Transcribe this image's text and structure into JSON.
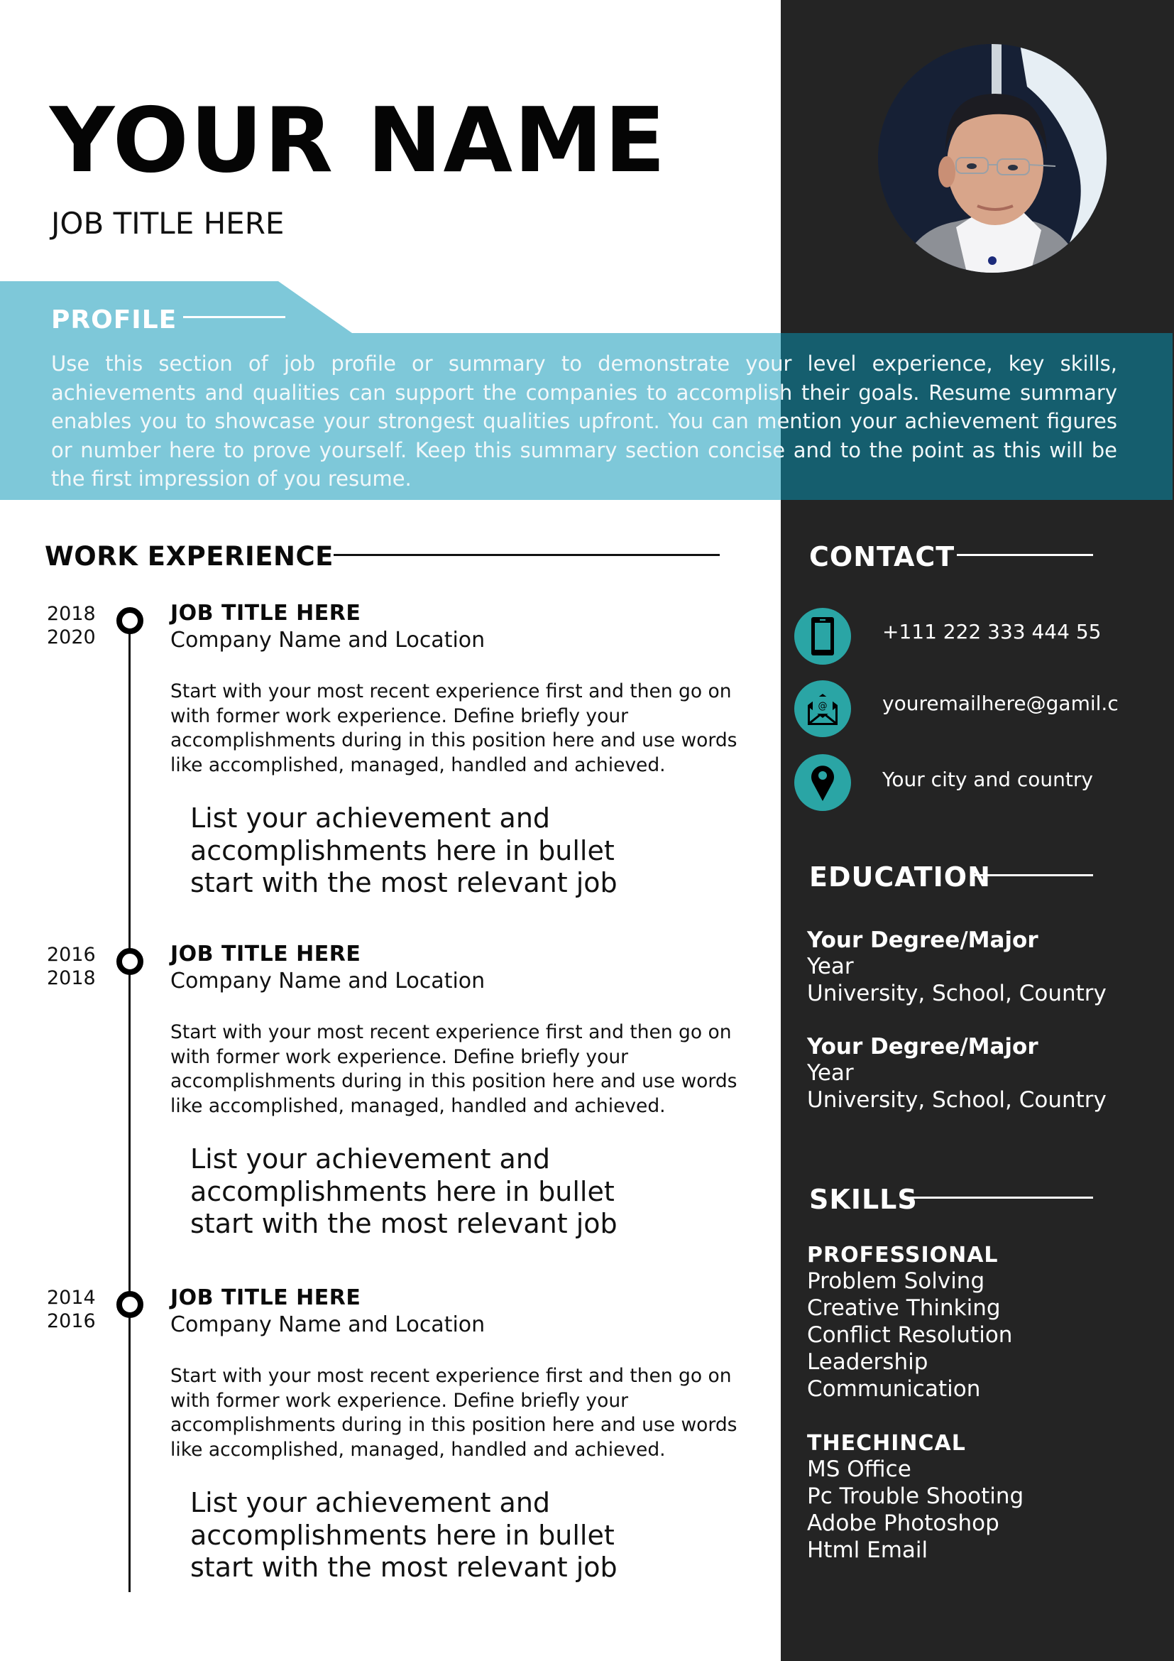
{
  "colors": {
    "sidebar": "#242424",
    "profile_light": "#7ec8d9",
    "profile_dark": "#155e6e",
    "icon_teal": "#2aa5a5",
    "text_dark": "#111111",
    "text_light": "#ffffff"
  },
  "header": {
    "name": "YOUR NAME",
    "job_title": "JOB TITLE HERE",
    "photo_icon": "profile-photo"
  },
  "profile": {
    "title": "PROFILE",
    "text": "Use this section of job profile or summary to demonstrate your level experience, key skills, achievements and qualities can support the companies to accomplish their goals. Resume summary enables you to showcase your strongest qualities upfront. You can mention your achievement figures or number here to prove yourself. Keep this summary section concise and to the point as this will be the first impression of you resume."
  },
  "work_experience": {
    "title": "WORK EXPERIENCE",
    "jobs": [
      {
        "year_start": "2018",
        "year_end": "2020",
        "title": "JOB TITLE HERE",
        "company": "Company Name and Location",
        "description": "Start with your most recent experience first and then go on with former work experience. Define briefly your accomplishments during in this position here and use words like accomplished, managed, handled and achieved.",
        "bullets": [
          "List your achievement and",
          "accomplishments here in bullet",
          "start with the most relevant job"
        ]
      },
      {
        "year_start": "2016",
        "year_end": "2018",
        "title": "JOB TITLE HERE",
        "company": "Company Name and Location",
        "description": "Start with your most recent experience first and then go on with former work experience. Define briefly your accomplishments during in this position here and use words like accomplished, managed, handled and achieved.",
        "bullets": [
          "List your achievement and",
          "accomplishments here in bullet",
          "start with the most relevant job"
        ]
      },
      {
        "year_start": "2014",
        "year_end": "2016",
        "title": "JOB TITLE HERE",
        "company": "Company Name and Location",
        "description": "Start with your most recent experience first and then go on with former work experience. Define briefly your accomplishments during in this position here and use words like accomplished, managed, handled and achieved.",
        "bullets": [
          "List your achievement and",
          "accomplishments here in bullet",
          "start with the most relevant job"
        ]
      }
    ]
  },
  "contact": {
    "title": "CONTACT",
    "items": [
      {
        "icon": "phone-icon",
        "text": "+111 222 333 444 55"
      },
      {
        "icon": "email-icon",
        "text": "youremailhere@gamil.c"
      },
      {
        "icon": "location-pin-icon",
        "text": "Your city and country"
      }
    ]
  },
  "education": {
    "title": "EDUCATION",
    "entries": [
      {
        "degree": "Your Degree/Major",
        "year": "Year",
        "school": "University, School, Country"
      },
      {
        "degree": "Your Degree/Major",
        "year": "Year",
        "school": "University, School, Country"
      }
    ]
  },
  "skills": {
    "title": "SKILLS",
    "groups": [
      {
        "heading": "PROFESSIONAL",
        "items": [
          "Problem Solving",
          "Creative Thinking",
          "Conflict Resolution",
          "Leadership",
          "Communication"
        ]
      },
      {
        "heading": "THECHINCAL",
        "items": [
          "MS Office",
          "Pc Trouble Shooting",
          "Adobe Photoshop",
          "Html Email"
        ]
      }
    ]
  }
}
